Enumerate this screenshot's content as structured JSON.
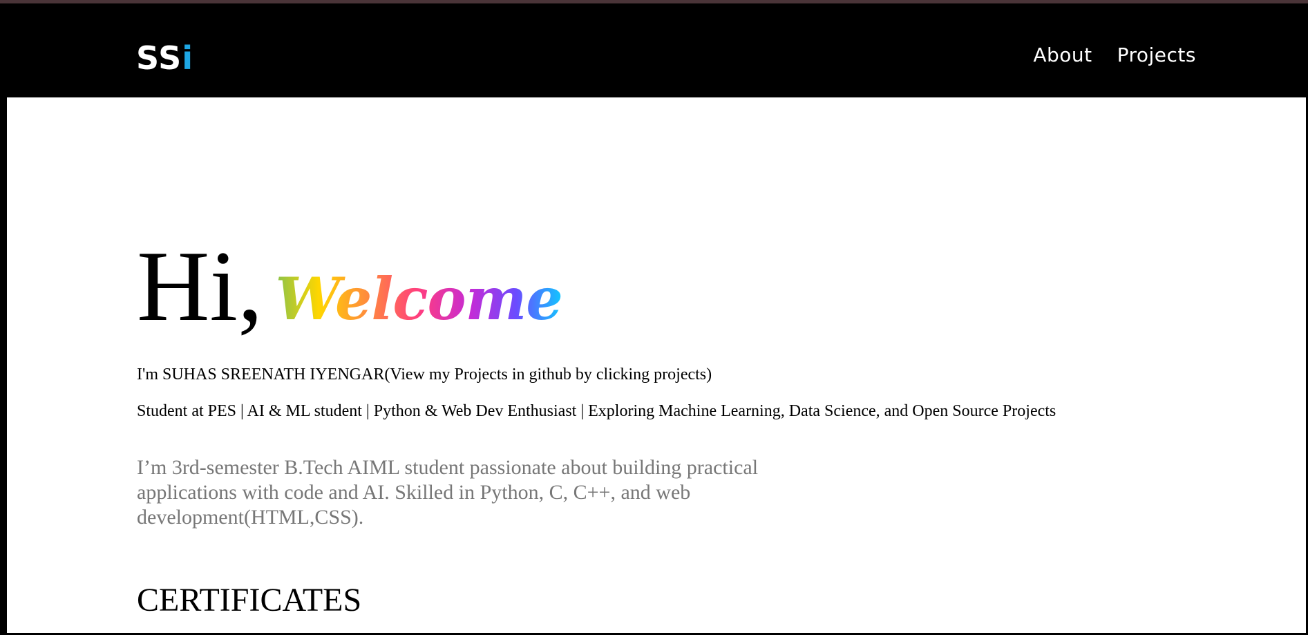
{
  "header": {
    "logo_main": "SS",
    "logo_accent": "i",
    "nav": [
      {
        "label": "About"
      },
      {
        "label": "Projects"
      }
    ]
  },
  "hero": {
    "greeting": "Hi,",
    "welcome": "Welcome"
  },
  "intro": "I'm SUHAS SREENATH IYENGAR(View my Projects in github by clicking projects)",
  "tagline": "Student at PES | AI & ML student | Python & Web Dev Enthusiast | Exploring Machine Learning, Data Science, and Open Source Projects",
  "description": "I’m 3rd-semester B.Tech AIML student passionate about building practical applications with code and AI. Skilled in Python, C, C++, and web development(HTML,CSS).",
  "certificates_heading": "CERTIFICATES",
  "colors": {
    "navbar_bg": "#000000",
    "logo_accent": "#1ea7e4",
    "description_text": "#777777",
    "welcome_gradient": [
      "#8bc34a",
      "#ffd600",
      "#ff8a3d",
      "#ff3d7f",
      "#c42bd6",
      "#6a4cff",
      "#10c8ff"
    ]
  }
}
